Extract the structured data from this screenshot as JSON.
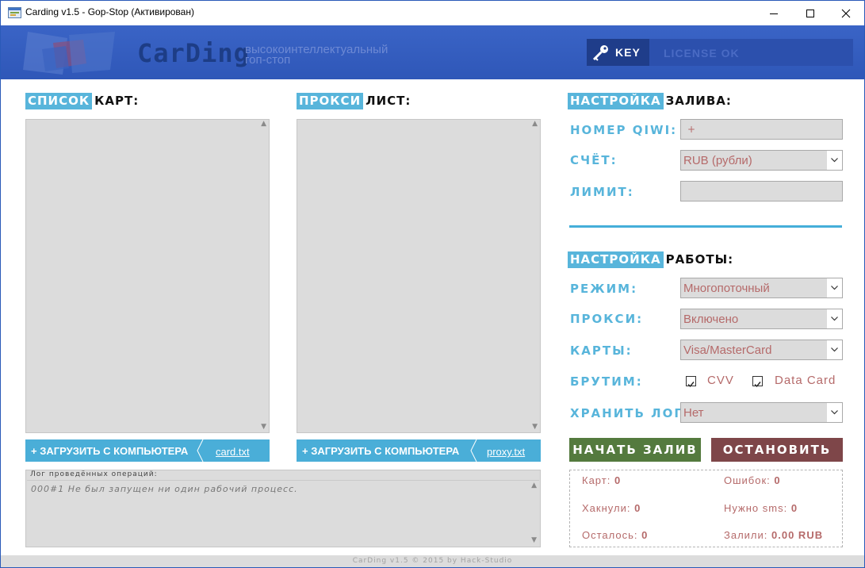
{
  "window": {
    "title": "Carding v1.5 - Gop-Stop (Активирован)"
  },
  "header": {
    "brand": "CarDing",
    "tagline_line1": "высокоинтеллектуальный",
    "tagline_line2": "гоп-стоп",
    "key_label": "KEY",
    "license_status": "LICENSE OK"
  },
  "cards": {
    "heading_highlight": "СПИСОК",
    "heading_rest": "КАРТ:",
    "load_label": "+ ЗАГРУЗИТЬ С КОМПЬЮТЕРА",
    "file_name": "card.txt"
  },
  "proxies": {
    "heading_highlight": "ПРОКСИ",
    "heading_rest": "ЛИСТ:",
    "load_label": "+ ЗАГРУЗИТЬ С КОМПЬЮТЕРА",
    "file_name": "proxy.txt"
  },
  "log": {
    "label": "Лог проведённых операций:",
    "lines": [
      "000#1 Не был запущен ни один рабочий процесс."
    ]
  },
  "fill_settings": {
    "heading_highlight": "НАСТРОЙКА",
    "heading_rest": "ЗАЛИВА:",
    "qiwi_label": "НОМЕР QIWI:",
    "qiwi_value": "+",
    "account_label": "СЧЁТ:",
    "account_value": "RUB (рубли)",
    "limit_label": "ЛИМИТ:",
    "limit_value": ""
  },
  "work_settings": {
    "heading_highlight": "НАСТРОЙКА",
    "heading_rest": "РАБОТЫ:",
    "mode_label": "РЕЖИМ:",
    "mode_value": "Многопоточный",
    "proxy_label": "ПРОКСИ:",
    "proxy_value": "Включено",
    "cards_label": "КАРТЫ:",
    "cards_value": "Visa/MasterCard",
    "brute_label": "БРУТИМ:",
    "brute_options": [
      {
        "label": "CVV",
        "checked": true
      },
      {
        "label": "Data Card",
        "checked": true
      }
    ],
    "store_log_label": "ХРАНИТЬ ЛОГ:",
    "store_log_value": "Нет"
  },
  "actions": {
    "start_label": "НАЧАТЬ ЗАЛИВ",
    "stop_label": "ОСТАНОВИТЬ"
  },
  "stats": {
    "cards_label": "Карт:",
    "cards_value": "0",
    "errors_label": "Ошибок:",
    "errors_value": "0",
    "hacked_label": "Хакнули:",
    "hacked_value": "0",
    "sms_label": "Нужно sms:",
    "sms_value": "0",
    "remaining_label": "Осталось:",
    "remaining_value": "0",
    "filled_label": "Залили:",
    "filled_value": "0.00 RUB"
  },
  "footer": {
    "text": "CarDing v1.5 © 2015 by Hack-Studio"
  },
  "colors": {
    "header_blue": "#2f57b8",
    "accent_cyan": "#58b5db",
    "value_red": "#b56a6a",
    "start_green": "#547a3e",
    "stop_red": "#7e4649"
  }
}
